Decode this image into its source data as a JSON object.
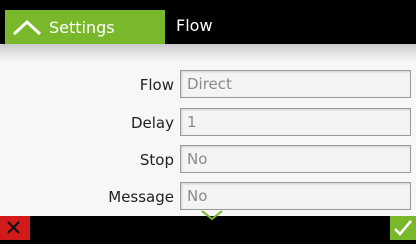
{
  "header": {
    "back_label": "Settings",
    "title": "Flow",
    "accent_color": "#79b82a"
  },
  "form": {
    "fields": [
      {
        "label": "Flow",
        "value": "Direct"
      },
      {
        "label": "Delay",
        "value": "1"
      },
      {
        "label": "Stop",
        "value": "No"
      },
      {
        "label": "Message",
        "value": "No"
      }
    ]
  },
  "footer": {
    "cancel_icon": "close-icon",
    "confirm_icon": "checkmark-icon",
    "scroll_icon": "chevron-down-icon",
    "cancel_color": "#d21a1a",
    "confirm_color": "#79b82a"
  }
}
